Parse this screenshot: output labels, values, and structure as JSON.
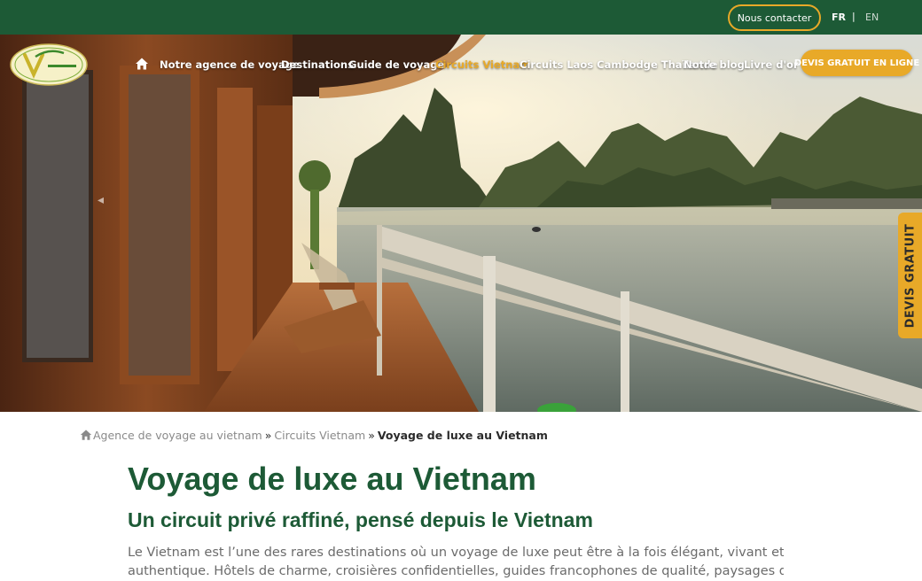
{
  "topbar": {
    "contact_label": "Nous contacter",
    "lang_fr": "FR",
    "lang_sep": "|",
    "lang_en": "EN"
  },
  "nav": {
    "items": [
      {
        "label": "Notre agence de voyage",
        "active": false
      },
      {
        "label": "Destinations",
        "active": false
      },
      {
        "label": "Guide de voyage",
        "active": false
      },
      {
        "label": "Circuits Vietnam",
        "active": true
      },
      {
        "label": "Circuits Laos Cambodge Thaïlande",
        "active": false
      },
      {
        "label": "Notre blog",
        "active": false
      },
      {
        "label": "Livre d'or",
        "active": false
      }
    ],
    "cta_label": "DEVIS GRATUIT EN LIGNE"
  },
  "side_tab": {
    "label": "DEVIS GRATUIT"
  },
  "breadcrumb": {
    "home_label": "Agence de voyage au vietnam",
    "sep": "»",
    "section_label": "Circuits Vietnam",
    "current_label": "Voyage de luxe au Vietnam"
  },
  "content": {
    "title": "Voyage de luxe au Vietnam",
    "subtitle": "Un circuit privé raffiné, pensé depuis le Vietnam",
    "intro_line1": "Le Vietnam est l’une des rares destinations où un voyage de luxe peut être à la fois élégant, vivant et profondément",
    "intro_line2": "authentique. Hôtels de charme, croisières confidentielles, guides francophones de qualité, paysages d’exception : chaque"
  },
  "colors": {
    "brand_green": "#1d5a36",
    "accent_gold": "#e8a928",
    "muted_text": "#6b6b6b"
  },
  "icons": {
    "home": "home-icon",
    "logo": "voyage-logo-icon"
  }
}
